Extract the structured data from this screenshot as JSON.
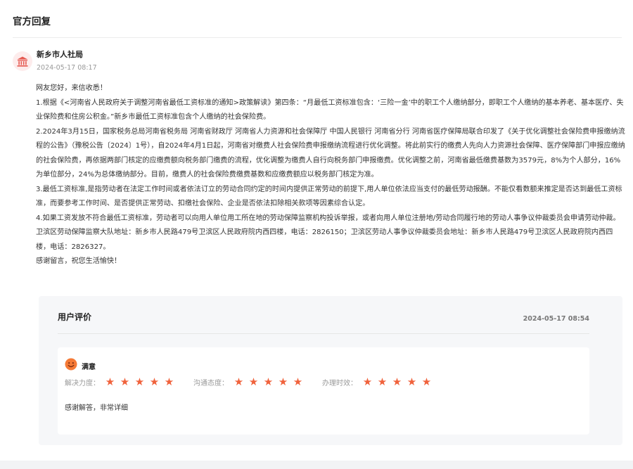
{
  "section": {
    "title": "官方回复"
  },
  "org": {
    "icon": "bank-building-icon",
    "name": "新乡市人社局",
    "time": "2024-05-17 08:17"
  },
  "reply": {
    "paragraphs": [
      "网友您好，来信收悉！",
      "1.根据《<河南省人民政府关于调整河南省最低工资标准的通知>政策解读》第四条：“月最低工资标准包含：‘三险一金’中的职工个人缴纳部分，即职工个人缴纳的基本养老、基本医疗、失业保险费和住房公积金。”新乡市最低工资标准包含个人缴纳的社会保险费。",
      "2.2024年3月15日，国家税务总局河南省税务局 河南省财政厅 河南省人力资源和社会保障厅 中国人民银行 河南省分行 河南省医疗保障局联合印发了《关于优化调整社会保险费申报缴纳流程的公告》（豫税公告〔2024〕1号），自2024年4月1日起，河南省对缴费人社会保险费申报缴纳流程进行优化调整。将此前实行的缴费人先向人力资源社会保障、医疗保障部门申报应缴纳的社会保险费，再依据两部门核定的应缴费额向税务部门缴费的流程，优化调整为缴费人自行向税务部门申报缴费。优化调整之前，河南省最低缴费基数为3579元，8%为个人部分，16%为单位部分，24%为总体缴纳部分。目前，缴费人的社会保险费缴费基数和应缴费额应以税务部门核定为准。",
      "3.最低工资标准,是指劳动者在法定工作时间或者依法订立的劳动合同约定的时间内提供正常劳动的前提下,用人单位依法应当支付的最低劳动报酬。不能仅看数额来推定是否达到最低工资标准，而要参考工作时间、是否提供正常劳动、扣缴社会保险、企业是否依法扣除相关款项等因素综合认定。",
      "4.如果工资发放不符合最低工资标准，劳动者可以向用人单位用工所在地的劳动保障监察机构投诉举报，或者向用人单位注册地/劳动合同履行地的劳动人事争议仲裁委员会申请劳动仲裁。卫滨区劳动保障监察大队地址：新乡市人民路479号卫滨区人民政府院内西四楼，电话：2826150；卫滨区劳动人事争议仲裁委员会地址：新乡市人民路479号卫滨区人民政府院内西四楼，电话：2826327。",
      "感谢留言，祝您生活愉快！"
    ]
  },
  "evaluation": {
    "title": "用户评价",
    "time": "2024-05-17 08:54",
    "satisfaction": {
      "icon": "smile-face-icon",
      "label": "满意"
    },
    "ratings": [
      {
        "label": "解决力度：",
        "score": 5,
        "max": 5
      },
      {
        "label": "沟通态度：",
        "score": 5,
        "max": 5
      },
      {
        "label": "办理时效：",
        "score": 5,
        "max": 5
      }
    ],
    "comment": "感谢解答，非常详细"
  },
  "colors": {
    "star": "#f0623c",
    "org_icon": "#e5584f",
    "smile_face": "#f57a36",
    "card_bg": "#f6f7f9"
  }
}
